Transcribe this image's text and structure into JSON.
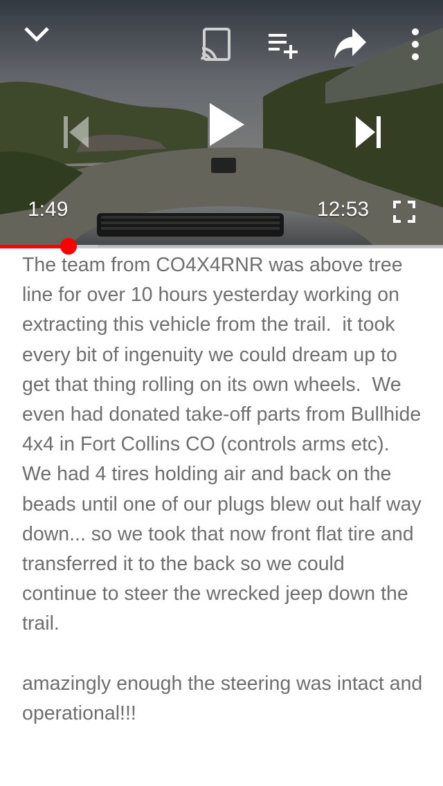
{
  "player": {
    "current_time": "1:49",
    "duration": "12:53",
    "progress_fraction": 0.154,
    "buffered_fraction": 0.22,
    "icons": {
      "minimize": "chevron-down-icon",
      "cast": "cast-icon",
      "add_to_queue": "add-to-queue-icon",
      "share": "share-icon",
      "more": "more-vertical-icon",
      "previous": "skip-previous-icon",
      "play": "play-icon",
      "next": "skip-next-icon",
      "fullscreen": "fullscreen-icon"
    },
    "colors": {
      "progress": "#ff0000",
      "controls": "#ffffff"
    }
  },
  "description": {
    "paragraphs": [
      "The team from CO4X4RNR was above tree line for over 10 hours yesterday working on extracting this vehicle from the trail.  it took every bit of ingenuity we could dream up to get that thing rolling on its own wheels.  We even had donated take-off parts from Bullhide 4x4 in Fort Collins CO (controls arms etc). We had 4 tires holding air and back on the beads until one of our plugs blew out half way down... so we took that now front flat tire and transferred it to the back so we could continue to steer the wrecked jeep down the trail.",
      "amazingly enough the steering was intact and operational!!!"
    ],
    "text_color": "#6e6e6e"
  }
}
